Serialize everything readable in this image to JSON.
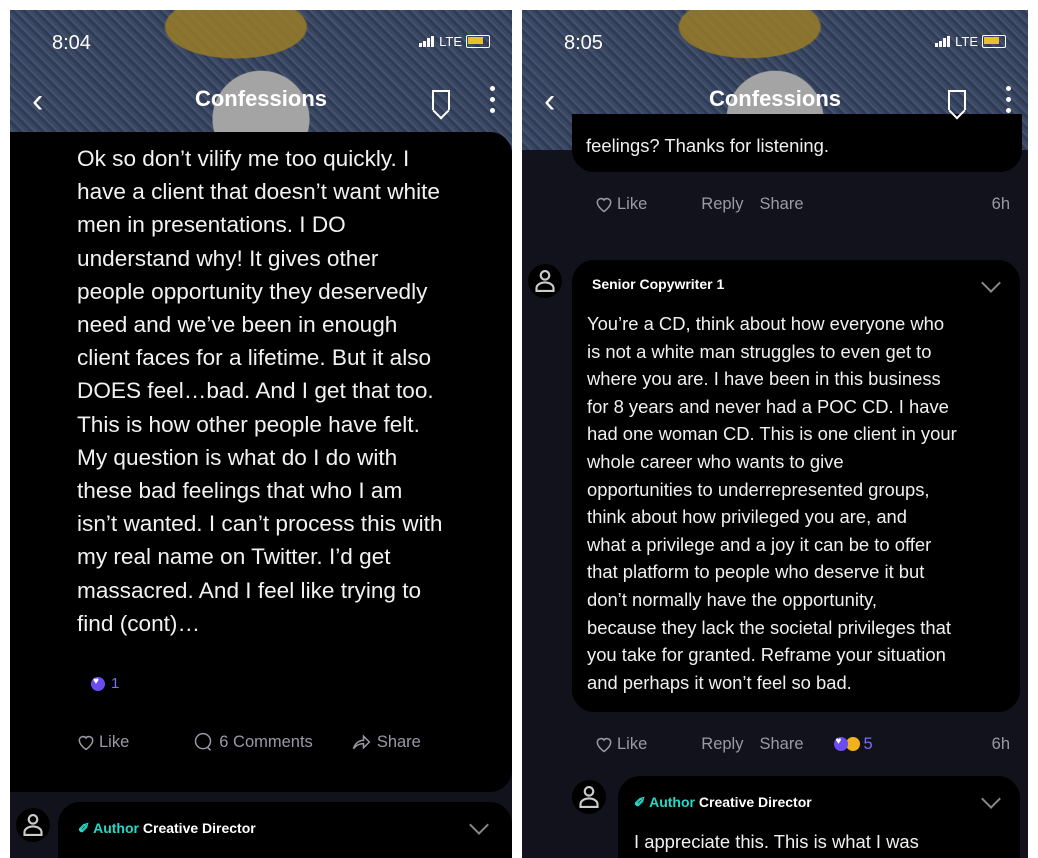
{
  "left": {
    "status": {
      "time": "8:04",
      "network": "LTE"
    },
    "nav": {
      "title": "Confessions"
    },
    "post": {
      "lines": [
        "Ok so don’t vilify me too quickly. I",
        "have a client that doesn’t want white",
        "men in presentations. I DO",
        "understand why! It gives other",
        "people opportunity they deservedly",
        "need and we’ve been in enough",
        "client faces for a lifetime. But it also",
        "DOES feel…bad. And I get that too.",
        "This is how other people have felt.",
        "My question is what do I do with",
        "these bad feelings that who I am",
        "isn’t wanted. I can’t process this with",
        "my real name on Twitter. I’d get",
        "massacred. And I feel like trying to",
        "find (cont)…"
      ],
      "reaction_count": "1",
      "like_label": "Like",
      "comments_label": "6 Comments",
      "share_label": "Share"
    },
    "reply_preview": {
      "author_tag": "Author",
      "role": "Creative Director"
    }
  },
  "right": {
    "status": {
      "time": "8:05",
      "network": "LTE"
    },
    "nav": {
      "title": "Confessions"
    },
    "prev_tail": "feelings? Thanks for listening.",
    "prev_actions": {
      "like": "Like",
      "reply": "Reply",
      "share": "Share",
      "time": "6h"
    },
    "comment": {
      "author": "Senior Copywriter 1",
      "lines": [
        "You’re a CD, think about how everyone who",
        "is not a white man struggles to even get to",
        "where you are. I have been in this business",
        "for 8 years and never had a POC CD. I have",
        "had one woman CD. This is one client in your",
        "whole career who wants to give",
        "opportunities to underrepresented groups,",
        "think about how privileged you are, and",
        "what a privilege and a joy it can be to offer",
        "that platform to people who deserve it but",
        "don’t normally have the opportunity,",
        "because they lack the societal privileges that",
        "you take for granted. Reframe your situation",
        "and perhaps it won’t feel so bad."
      ],
      "actions": {
        "like": "Like",
        "reply": "Reply",
        "share": "Share",
        "reaction_count": "5",
        "time": "6h"
      }
    },
    "reply": {
      "author_tag": "Author",
      "role": "Creative Director",
      "text": "I appreciate this. This is what I was"
    }
  },
  "colors": {
    "accent_teal": "#25d9c7",
    "reaction_purple": "#6b4cf0",
    "card_bg": "#000000",
    "screen_bg": "#12121c"
  }
}
